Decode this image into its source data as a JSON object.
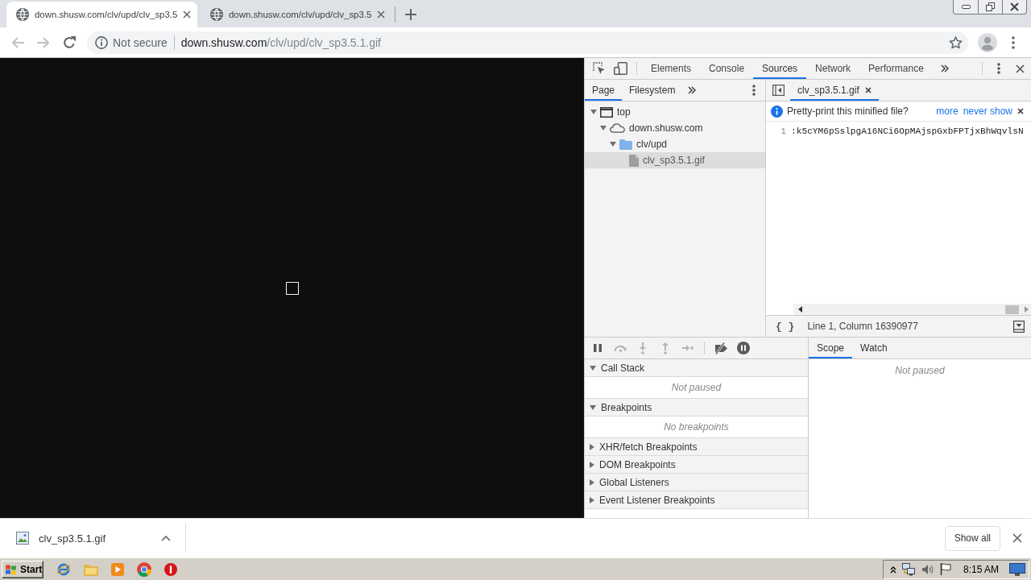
{
  "browser_tabs": [
    {
      "title": "down.shusw.com/clv/upd/clv_sp3.5",
      "selected": true
    },
    {
      "title": "down.shusw.com/clv/upd/clv_sp3.5",
      "selected": false
    }
  ],
  "address_bar": {
    "security_label": "Not secure",
    "url": {
      "host": "down.shusw.com",
      "path": "/clv/upd/clv_sp3.5.1.gif"
    }
  },
  "devtools": {
    "tabs": [
      {
        "label": "Elements",
        "selected": false
      },
      {
        "label": "Console",
        "selected": false
      },
      {
        "label": "Sources",
        "selected": true
      },
      {
        "label": "Network",
        "selected": false
      },
      {
        "label": "Performance",
        "selected": false
      }
    ],
    "navigator": {
      "tabs": [
        {
          "label": "Page",
          "selected": true
        },
        {
          "label": "Filesystem",
          "selected": false
        }
      ],
      "tree": [
        {
          "label": "top",
          "kind": "frame",
          "expanded": true,
          "selected": false,
          "children": [
            {
              "label": "down.shusw.com",
              "kind": "domain",
              "expanded": true,
              "selected": false,
              "children": [
                {
                  "label": "clv/upd",
                  "kind": "folder",
                  "expanded": true,
                  "selected": false,
                  "children": [
                    {
                      "label": "clv_sp3.5.1.gif",
                      "kind": "file",
                      "selected": true
                    }
                  ]
                }
              ]
            }
          ]
        }
      ]
    },
    "editor": {
      "tabs": [
        {
          "label": "clv_sp3.5.1.gif",
          "selected": true
        }
      ],
      "infobar": {
        "message": "Pretty-print this minified file?",
        "links": [
          "more",
          "never show"
        ]
      },
      "lines": [
        {
          "number": "1",
          "text": ":k5cYM6pSslpgA16NCi6OpMAjspGxbFPTjxBhWqvlsN"
        }
      ],
      "status": {
        "format_button": "{ }",
        "position": "Line 1, Column 16390977"
      }
    },
    "debugger": {
      "toolbar": [
        {
          "kind": "pause",
          "disabled": false
        },
        {
          "kind": "step_over",
          "disabled": true
        },
        {
          "kind": "step_into",
          "disabled": true
        },
        {
          "kind": "step_out",
          "disabled": true
        },
        {
          "kind": "step",
          "disabled": true
        },
        {
          "kind": "deactivate_breakpoints",
          "disabled": false
        },
        {
          "kind": "pause_on_exceptions",
          "disabled": false
        }
      ],
      "sections": [
        {
          "title": "Call Stack",
          "expanded": true,
          "message": "Not paused"
        },
        {
          "title": "Breakpoints",
          "expanded": true,
          "message": "No breakpoints"
        },
        {
          "title": "XHR/fetch Breakpoints",
          "expanded": false
        },
        {
          "title": "DOM Breakpoints",
          "expanded": false
        },
        {
          "title": "Global Listeners",
          "expanded": false
        },
        {
          "title": "Event Listener Breakpoints",
          "expanded": false
        }
      ],
      "sidebar": {
        "tabs": [
          {
            "label": "Scope",
            "selected": true
          },
          {
            "label": "Watch",
            "selected": false
          }
        ],
        "message": "Not paused"
      }
    }
  },
  "download_bar": {
    "items": [
      {
        "filename": "clv_sp3.5.1.gif"
      }
    ],
    "show_all": "Show all"
  },
  "taskbar": {
    "start": "Start",
    "clock": "8:15 AM"
  }
}
